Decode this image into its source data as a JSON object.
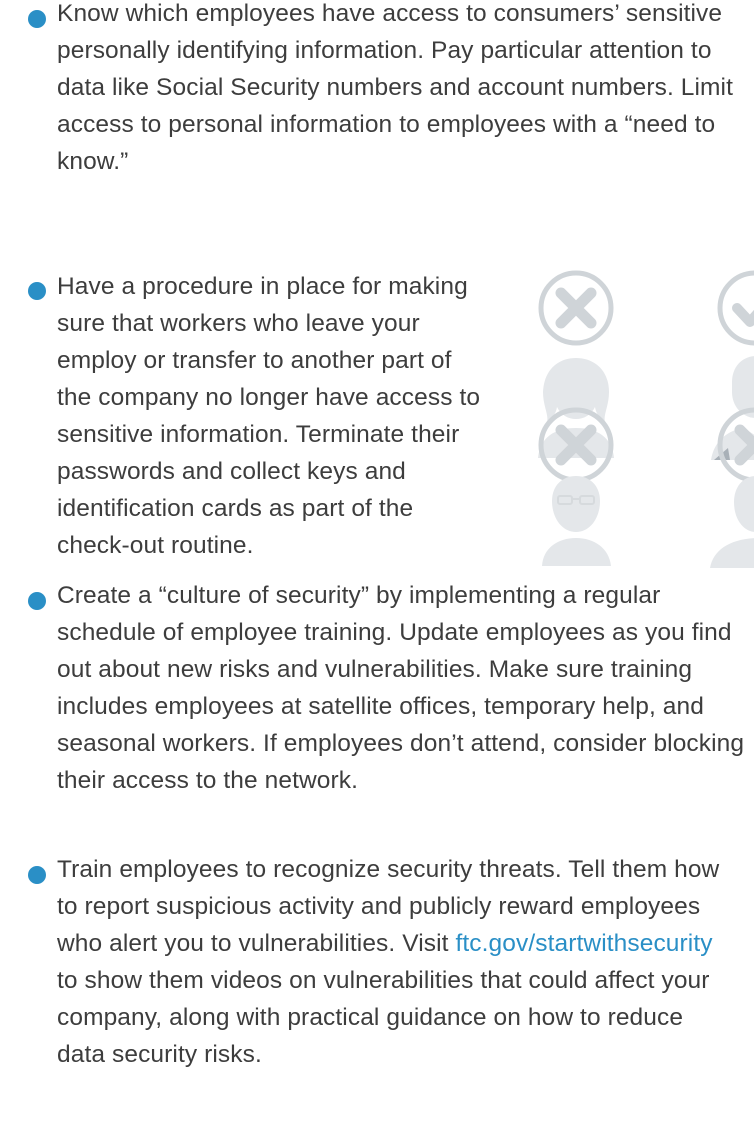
{
  "bullets": [
    {
      "text": "Know which employees have access to consumers’ sensitive personally identifying information. Pay particular attention to data like Social Security numbers and account numbers. Limit access to personal information to employees with a “need to know.”"
    },
    {
      "text": "Have a procedure in place for making sure that workers who leave your employ or transfer to another part of the company no longer have access to sensitive information. Terminate their passwords and collect keys and identification cards as part of the check-out routine."
    },
    {
      "text": "Create a “culture of security” by implementing a regular schedule of employee training. Update employees as you find out about new risks and vulnerabilities. Make sure training includes employees at satellite offices, temporary help, and seasonal workers. If employees don’t attend, consider blocking their access to the network."
    },
    {
      "text_before": "Train employees to recognize security threats. Tell them how to report suspicious activity and publicly reward employees who alert you to vulnerabilities. Visit ",
      "link_text": "ftc.gov/startwithsecurity",
      "text_after": " to show them videos on vulnerabilities that could affect your company, along with practical guidance on how to reduce data security risks."
    }
  ],
  "colors": {
    "bullet": "#2a8fc6",
    "link": "#2a8fc6",
    "text": "#3d3d3d",
    "illustration": "#cfd4d8"
  },
  "illustration": {
    "icons": [
      "x-mark-icon",
      "check-mark-icon",
      "x-mark-icon",
      "x-mark-icon"
    ],
    "people": [
      "woman-avatar-icon",
      "man-avatar-icon",
      "man-glasses-avatar-icon",
      "person-avatar-icon"
    ]
  }
}
